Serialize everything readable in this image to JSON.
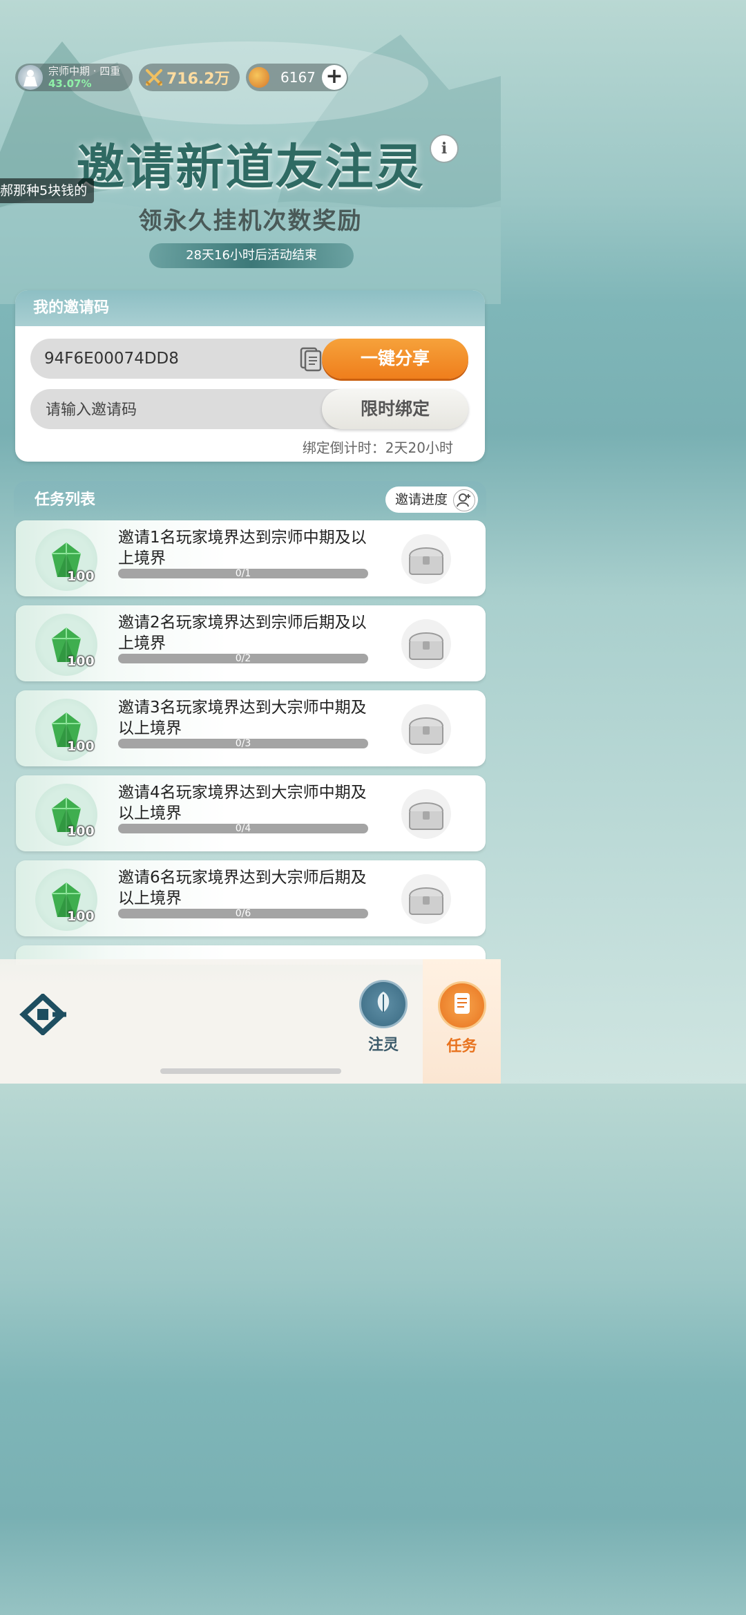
{
  "status_bar": {
    "rank_name": "宗师中期 · 四重",
    "rank_progress": "43.07%",
    "power": "716.2万",
    "coins": "6167",
    "plus_icon": "plus-icon"
  },
  "banner": {
    "title": "邀请新道友注灵",
    "subtitle": "领永久挂机次数奖励",
    "countdown": "28天16小时后活动结束",
    "info_icon": "i"
  },
  "danmaku": "郝那种5块钱的",
  "invite_card": {
    "header": "我的邀请码",
    "my_code": "94F6E00074DD8",
    "share_button": "一键分享",
    "input_placeholder": "请输入邀请码",
    "bind_button": "限时绑定",
    "bind_countdown": "绑定倒计时：2天20小时"
  },
  "task_list": {
    "header": "任务列表",
    "progress_button": "邀请进度",
    "tasks": [
      {
        "title": "邀请1名玩家境界达到宗师中期及以上境界",
        "progress_text": "0/1",
        "progress": 0,
        "reward_count": "100"
      },
      {
        "title": "邀请2名玩家境界达到宗师后期及以上境界",
        "progress_text": "0/2",
        "progress": 0,
        "reward_count": "100"
      },
      {
        "title": "邀请3名玩家境界达到大宗师中期及以上境界",
        "progress_text": "0/3",
        "progress": 0,
        "reward_count": "100"
      },
      {
        "title": "邀请4名玩家境界达到大宗师中期及以上境界",
        "progress_text": "0/4",
        "progress": 0,
        "reward_count": "100"
      },
      {
        "title": "邀请6名玩家境界达到大宗师后期及以上境界",
        "progress_text": "0/6",
        "progress": 0,
        "reward_count": "100"
      }
    ]
  },
  "bottom_nav": {
    "tab_zhuling": "注灵",
    "tab_renwu": "任务",
    "active": "任务"
  },
  "colors": {
    "accent_orange": "#ef7e1c",
    "teal": "#2f6a63",
    "progress_empty": "#a4a4a4"
  }
}
